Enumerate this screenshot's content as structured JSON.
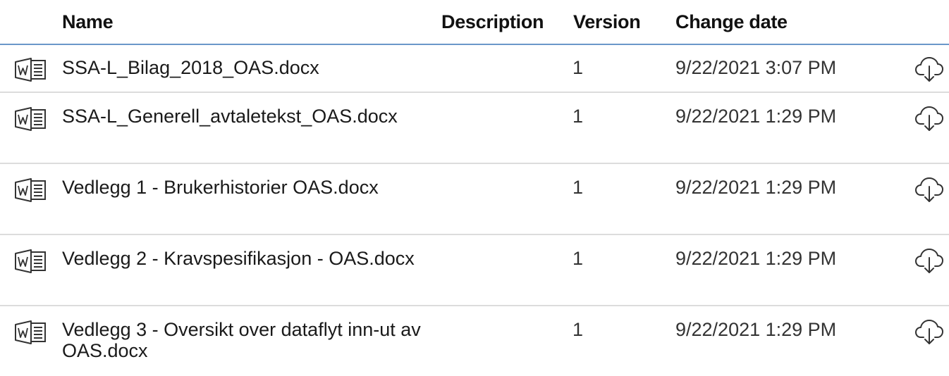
{
  "columns": {
    "name": "Name",
    "description": "Description",
    "version": "Version",
    "change_date": "Change date"
  },
  "files": [
    {
      "icon": "word-document-icon",
      "name": "SSA-L_Bilag_2018_OAS.docx",
      "description": "",
      "version": "1",
      "change_date": "9/22/2021 3:07 PM",
      "action_icon": "cloud-download-icon"
    },
    {
      "icon": "word-document-icon",
      "name": "SSA-L_Generell_avtaletekst_OAS.docx",
      "description": "",
      "version": "1",
      "change_date": "9/22/2021 1:29 PM",
      "action_icon": "cloud-download-icon"
    },
    {
      "icon": "word-document-icon",
      "name": "Vedlegg 1 - Brukerhistorier OAS.docx",
      "description": "",
      "version": "1",
      "change_date": "9/22/2021 1:29 PM",
      "action_icon": "cloud-download-icon"
    },
    {
      "icon": "word-document-icon",
      "name": "Vedlegg 2 - Kravspesifikasjon - OAS.docx",
      "description": "",
      "version": "1",
      "change_date": "9/22/2021 1:29 PM",
      "action_icon": "cloud-download-icon"
    },
    {
      "icon": "word-document-icon",
      "name": "Vedlegg 3 - Oversikt over dataflyt inn-ut av OAS.docx",
      "description": "",
      "version": "1",
      "change_date": "9/22/2021 1:29 PM",
      "action_icon": "cloud-download-icon"
    }
  ],
  "colors": {
    "header_rule": "#6a97c9",
    "row_divider": "#dcdcdc",
    "icon_stroke": "#333333"
  }
}
